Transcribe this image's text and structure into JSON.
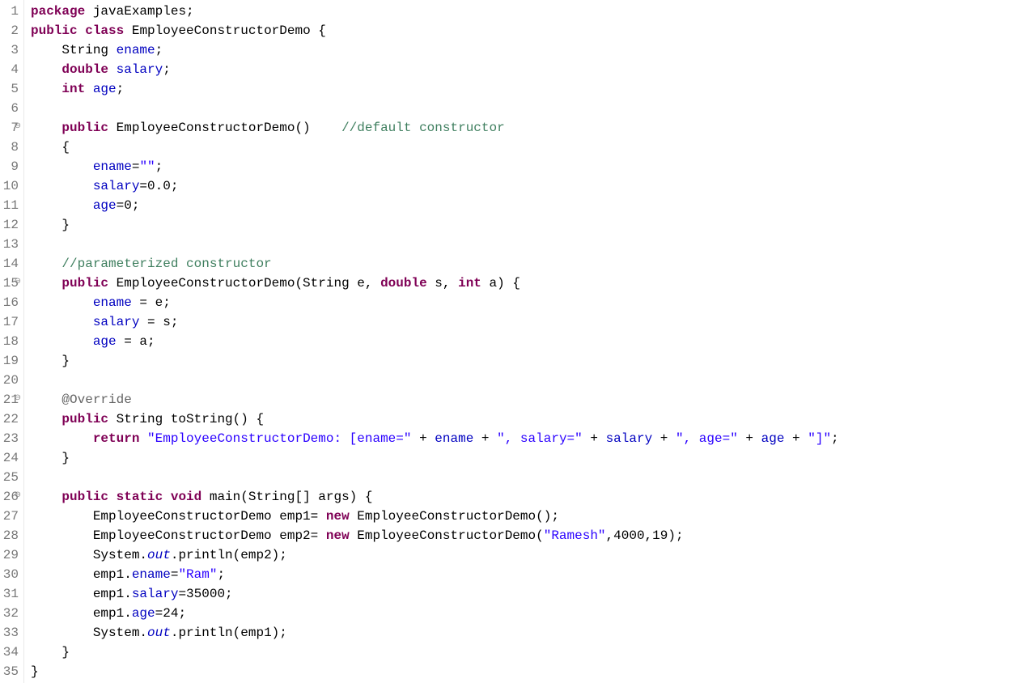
{
  "language": "java",
  "lines": [
    {
      "num": "1",
      "fold": "",
      "tokens": [
        [
          "kw",
          "package"
        ],
        [
          "txt",
          " javaExamples;"
        ]
      ]
    },
    {
      "num": "2",
      "fold": "",
      "tokens": [
        [
          "kw",
          "public"
        ],
        [
          "txt",
          " "
        ],
        [
          "kw",
          "class"
        ],
        [
          "txt",
          " EmployeeConstructorDemo {"
        ]
      ]
    },
    {
      "num": "3",
      "fold": "",
      "tokens": [
        [
          "txt",
          "    String "
        ],
        [
          "field",
          "ename"
        ],
        [
          "txt",
          ";"
        ]
      ]
    },
    {
      "num": "4",
      "fold": "",
      "tokens": [
        [
          "txt",
          "    "
        ],
        [
          "kw",
          "double"
        ],
        [
          "txt",
          " "
        ],
        [
          "field",
          "salary"
        ],
        [
          "txt",
          ";"
        ]
      ]
    },
    {
      "num": "5",
      "fold": "",
      "tokens": [
        [
          "txt",
          "    "
        ],
        [
          "kw",
          "int"
        ],
        [
          "txt",
          " "
        ],
        [
          "field",
          "age"
        ],
        [
          "txt",
          ";"
        ]
      ]
    },
    {
      "num": "6",
      "fold": "",
      "tokens": []
    },
    {
      "num": "7",
      "fold": "⊖",
      "tokens": [
        [
          "txt",
          "    "
        ],
        [
          "kw",
          "public"
        ],
        [
          "txt",
          " EmployeeConstructorDemo()    "
        ],
        [
          "cm",
          "//default constructor"
        ]
      ]
    },
    {
      "num": "8",
      "fold": "",
      "tokens": [
        [
          "txt",
          "    {"
        ]
      ]
    },
    {
      "num": "9",
      "fold": "",
      "tokens": [
        [
          "txt",
          "        "
        ],
        [
          "field",
          "ename"
        ],
        [
          "txt",
          "="
        ],
        [
          "str",
          "\"\""
        ],
        [
          "txt",
          ";"
        ]
      ]
    },
    {
      "num": "10",
      "fold": "",
      "tokens": [
        [
          "txt",
          "        "
        ],
        [
          "field",
          "salary"
        ],
        [
          "txt",
          "=0.0;"
        ]
      ]
    },
    {
      "num": "11",
      "fold": "",
      "tokens": [
        [
          "txt",
          "        "
        ],
        [
          "field",
          "age"
        ],
        [
          "txt",
          "=0;"
        ]
      ]
    },
    {
      "num": "12",
      "fold": "",
      "tokens": [
        [
          "txt",
          "    }"
        ]
      ]
    },
    {
      "num": "13",
      "fold": "",
      "tokens": []
    },
    {
      "num": "14",
      "fold": "",
      "tokens": [
        [
          "txt",
          "    "
        ],
        [
          "cm",
          "//parameterized constructor"
        ]
      ]
    },
    {
      "num": "15",
      "fold": "⊖",
      "tokens": [
        [
          "txt",
          "    "
        ],
        [
          "kw",
          "public"
        ],
        [
          "txt",
          " EmployeeConstructorDemo(String e, "
        ],
        [
          "kw",
          "double"
        ],
        [
          "txt",
          " s, "
        ],
        [
          "kw",
          "int"
        ],
        [
          "txt",
          " a) {"
        ]
      ]
    },
    {
      "num": "16",
      "fold": "",
      "tokens": [
        [
          "txt",
          "        "
        ],
        [
          "field",
          "ename"
        ],
        [
          "txt",
          " = e;"
        ]
      ]
    },
    {
      "num": "17",
      "fold": "",
      "tokens": [
        [
          "txt",
          "        "
        ],
        [
          "field",
          "salary"
        ],
        [
          "txt",
          " = s;"
        ]
      ]
    },
    {
      "num": "18",
      "fold": "",
      "tokens": [
        [
          "txt",
          "        "
        ],
        [
          "field",
          "age"
        ],
        [
          "txt",
          " = a;"
        ]
      ]
    },
    {
      "num": "19",
      "fold": "",
      "tokens": [
        [
          "txt",
          "    }"
        ]
      ]
    },
    {
      "num": "20",
      "fold": "",
      "tokens": []
    },
    {
      "num": "21",
      "fold": "⊖",
      "tokens": [
        [
          "txt",
          "    "
        ],
        [
          "ann",
          "@Override"
        ]
      ]
    },
    {
      "num": "22",
      "fold": "",
      "tokens": [
        [
          "txt",
          "    "
        ],
        [
          "kw",
          "public"
        ],
        [
          "txt",
          " String toString() {"
        ]
      ]
    },
    {
      "num": "23",
      "fold": "",
      "tokens": [
        [
          "txt",
          "        "
        ],
        [
          "kw",
          "return"
        ],
        [
          "txt",
          " "
        ],
        [
          "str",
          "\"EmployeeConstructorDemo: [ename=\""
        ],
        [
          "txt",
          " + "
        ],
        [
          "field",
          "ename"
        ],
        [
          "txt",
          " + "
        ],
        [
          "str",
          "\", salary=\""
        ],
        [
          "txt",
          " + "
        ],
        [
          "field",
          "salary"
        ],
        [
          "txt",
          " + "
        ],
        [
          "str",
          "\", age=\""
        ],
        [
          "txt",
          " + "
        ],
        [
          "field",
          "age"
        ],
        [
          "txt",
          " + "
        ],
        [
          "str",
          "\"]\""
        ],
        [
          "txt",
          ";"
        ]
      ]
    },
    {
      "num": "24",
      "fold": "",
      "tokens": [
        [
          "txt",
          "    }"
        ]
      ]
    },
    {
      "num": "25",
      "fold": "",
      "tokens": []
    },
    {
      "num": "26",
      "fold": "⊖",
      "tokens": [
        [
          "txt",
          "    "
        ],
        [
          "kw",
          "public"
        ],
        [
          "txt",
          " "
        ],
        [
          "kw",
          "static"
        ],
        [
          "txt",
          " "
        ],
        [
          "kw",
          "void"
        ],
        [
          "txt",
          " main(String[] args) {"
        ]
      ]
    },
    {
      "num": "27",
      "fold": "",
      "tokens": [
        [
          "txt",
          "        EmployeeConstructorDemo emp1= "
        ],
        [
          "kw",
          "new"
        ],
        [
          "txt",
          " EmployeeConstructorDemo();"
        ]
      ]
    },
    {
      "num": "28",
      "fold": "",
      "tokens": [
        [
          "txt",
          "        EmployeeConstructorDemo emp2= "
        ],
        [
          "kw",
          "new"
        ],
        [
          "txt",
          " EmployeeConstructorDemo("
        ],
        [
          "str",
          "\"Ramesh\""
        ],
        [
          "txt",
          ",4000,19);"
        ]
      ]
    },
    {
      "num": "29",
      "fold": "",
      "tokens": [
        [
          "txt",
          "        System."
        ],
        [
          "static-field",
          "out"
        ],
        [
          "txt",
          ".println(emp2);"
        ]
      ]
    },
    {
      "num": "30",
      "fold": "",
      "tokens": [
        [
          "txt",
          "        emp1."
        ],
        [
          "field",
          "ename"
        ],
        [
          "txt",
          "="
        ],
        [
          "str",
          "\"Ram\""
        ],
        [
          "txt",
          ";"
        ]
      ]
    },
    {
      "num": "31",
      "fold": "",
      "tokens": [
        [
          "txt",
          "        emp1."
        ],
        [
          "field",
          "salary"
        ],
        [
          "txt",
          "=35000;"
        ]
      ]
    },
    {
      "num": "32",
      "fold": "",
      "tokens": [
        [
          "txt",
          "        emp1."
        ],
        [
          "field",
          "age"
        ],
        [
          "txt",
          "=24;"
        ]
      ]
    },
    {
      "num": "33",
      "fold": "",
      "tokens": [
        [
          "txt",
          "        System."
        ],
        [
          "static-field",
          "out"
        ],
        [
          "txt",
          ".println(emp1);"
        ]
      ]
    },
    {
      "num": "34",
      "fold": "",
      "tokens": [
        [
          "txt",
          "    }"
        ]
      ]
    },
    {
      "num": "35",
      "fold": "",
      "tokens": [
        [
          "txt",
          "}"
        ]
      ]
    }
  ]
}
